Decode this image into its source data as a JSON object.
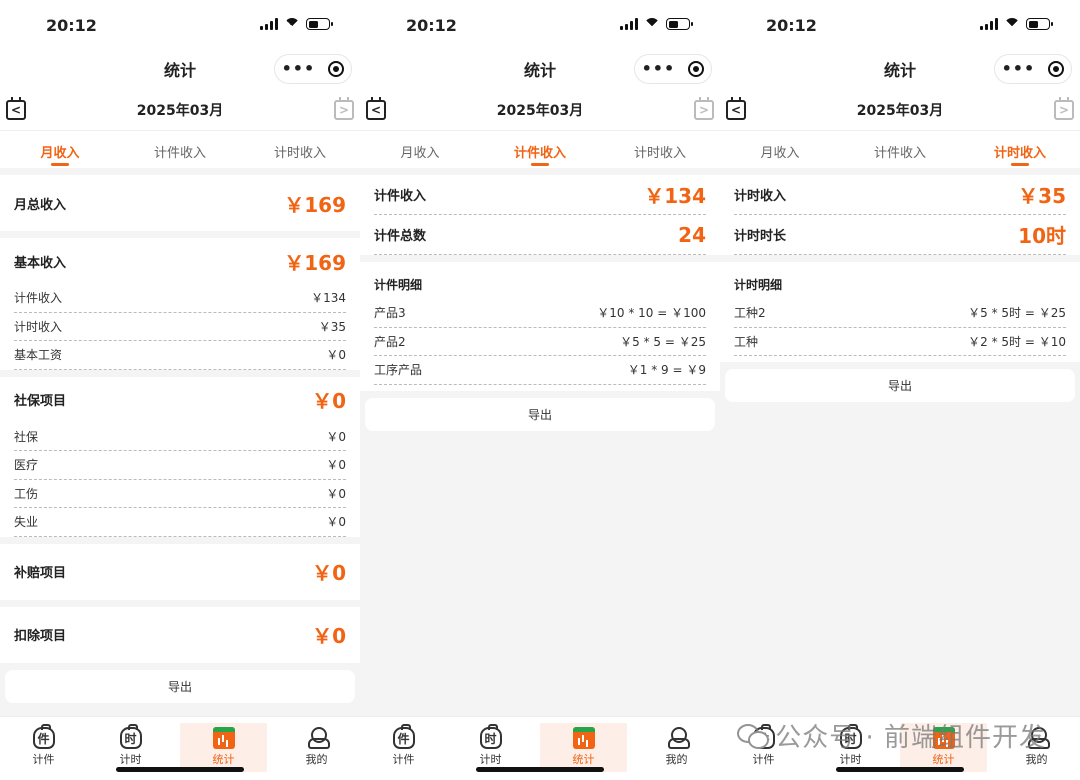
{
  "status": {
    "time": "20:12"
  },
  "nav": {
    "title": "统计",
    "menu_glyph": "•••"
  },
  "date": {
    "label": "2025年03月",
    "prev_glyph": "<",
    "next_glyph": ">"
  },
  "tabs": [
    "月收入",
    "计件收入",
    "计时收入"
  ],
  "panel1": {
    "total": {
      "label": "月总收入",
      "value": "￥169"
    },
    "basic": {
      "label": "基本收入",
      "value": "￥169",
      "items": [
        {
          "label": "计件收入",
          "value": "￥134"
        },
        {
          "label": "计时收入",
          "value": "￥35"
        },
        {
          "label": "基本工资",
          "value": "￥0"
        }
      ]
    },
    "social": {
      "label": "社保项目",
      "value": "￥0",
      "items": [
        {
          "label": "社保",
          "value": "￥0"
        },
        {
          "label": "医疗",
          "value": "￥0"
        },
        {
          "label": "工伤",
          "value": "￥0"
        },
        {
          "label": "失业",
          "value": "￥0"
        }
      ]
    },
    "subsidy": {
      "label": "补赔项目",
      "value": "￥0"
    },
    "deduct": {
      "label": "扣除项目",
      "value": "￥0"
    },
    "export": "导出"
  },
  "panel2": {
    "income": {
      "label": "计件收入",
      "value": "￥134"
    },
    "count": {
      "label": "计件总数",
      "value": "24"
    },
    "detail_title": "计件明细",
    "details": [
      {
        "label": "产品3",
        "value": "￥10 * 10 = ￥100"
      },
      {
        "label": "产品2",
        "value": "￥5 * 5 = ￥25"
      },
      {
        "label": "工序产品",
        "value": "￥1 * 9 = ￥9"
      }
    ],
    "export": "导出"
  },
  "panel3": {
    "income": {
      "label": "计时收入",
      "value": "￥35"
    },
    "duration": {
      "label": "计时时长",
      "value": "10时"
    },
    "detail_title": "计时明细",
    "details": [
      {
        "label": "工种2",
        "value": "￥5 * 5时 = ￥25"
      },
      {
        "label": "工种",
        "value": "￥2 * 5时 = ￥10"
      }
    ],
    "export": "导出"
  },
  "tabbar": {
    "items": [
      {
        "label": "计件",
        "glyph": "件",
        "icon": "money-bag-icon"
      },
      {
        "label": "计时",
        "glyph": "时",
        "icon": "money-bag-icon"
      },
      {
        "label": "统计",
        "icon": "chart-calendar-icon"
      },
      {
        "label": "我的",
        "icon": "user-icon"
      }
    ]
  },
  "watermark": "公众号 · 前端组件开发",
  "colors": {
    "accent": "#f06414",
    "active_tab_bg": "#fdeee7"
  }
}
